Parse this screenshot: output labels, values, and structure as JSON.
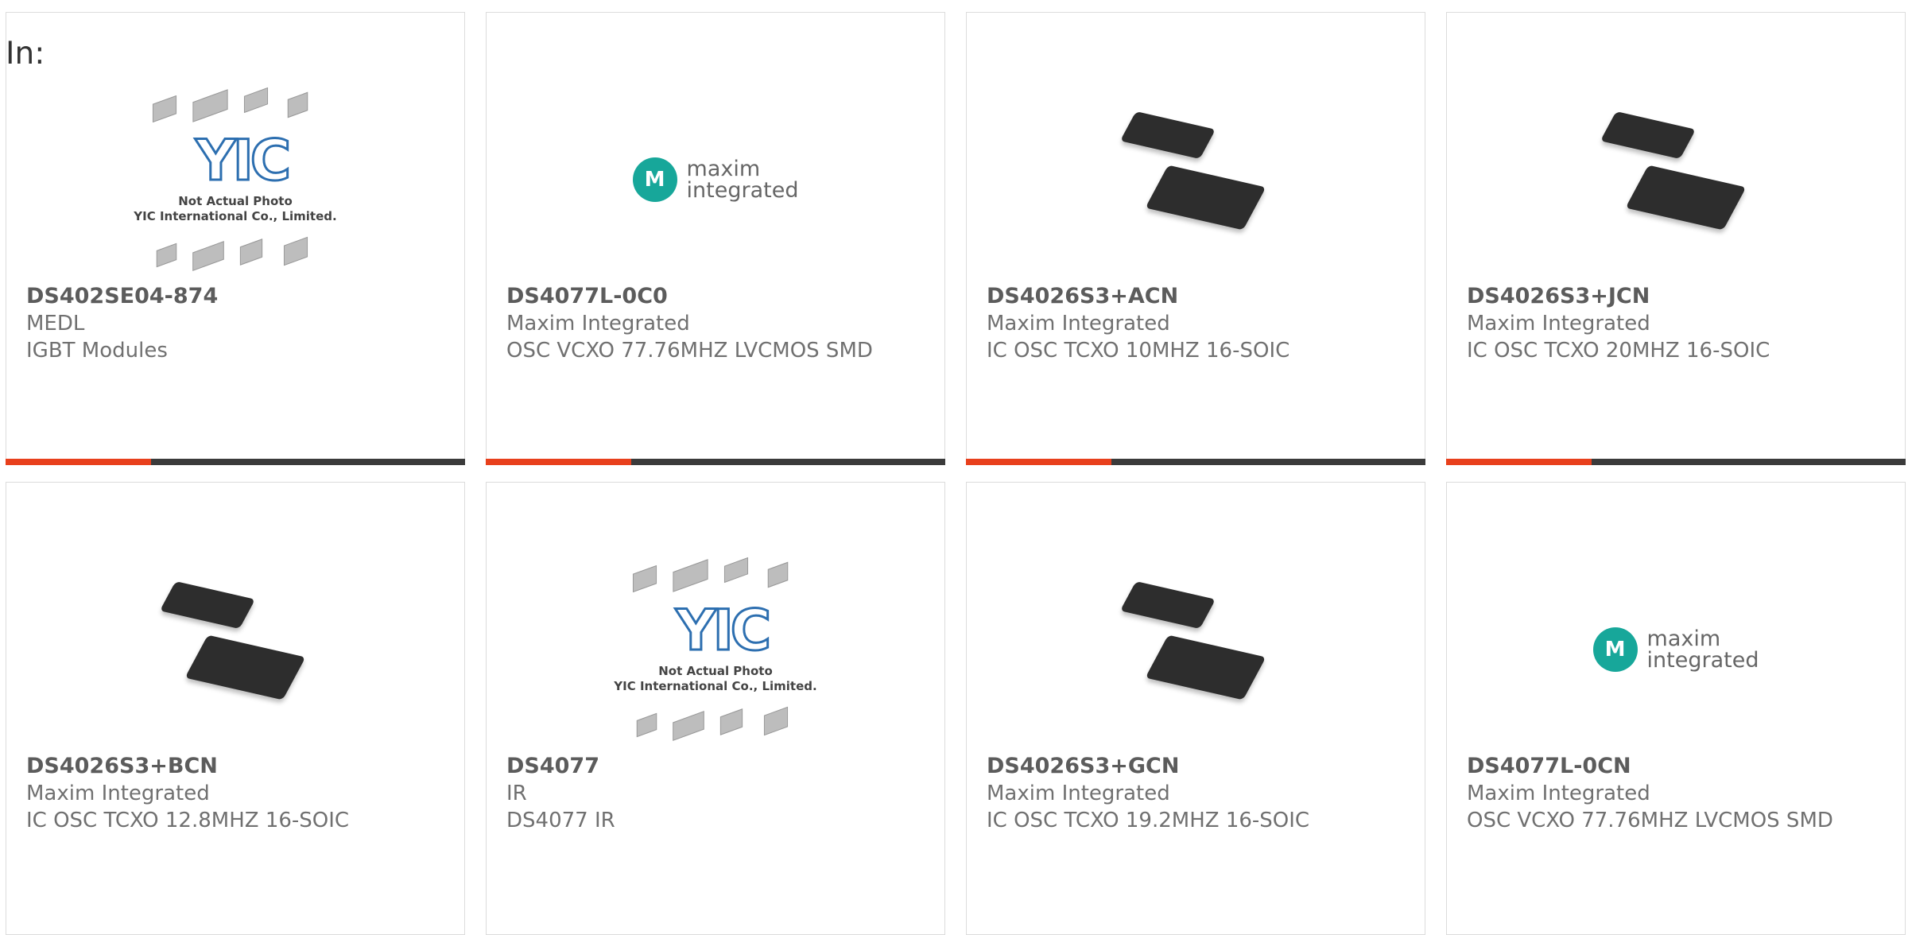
{
  "heading": "In:",
  "colors": {
    "accent": "#e8401c",
    "bar": "#3b3b3b",
    "maxim_teal": "#17a79a"
  },
  "placeholder": {
    "line1": "Not Actual Photo",
    "line2": "YIC International Co., Limited.",
    "logo": "YIC"
  },
  "maxim_logo": {
    "symbol": "M",
    "line1": "maxim",
    "line2": "integrated"
  },
  "products": [
    {
      "part": "DS402SE04-874",
      "manufacturer": "MEDL",
      "description": "IGBT Modules",
      "image": "yic-placeholder"
    },
    {
      "part": "DS4077L-0C0",
      "manufacturer": "Maxim Integrated",
      "description": "OSC VCXO 77.76MHZ LVCMOS SMD",
      "image": "maxim-logo"
    },
    {
      "part": "DS4026S3+ACN",
      "manufacturer": "Maxim Integrated",
      "description": "IC OSC TCXO 10MHZ 16-SOIC",
      "image": "soic-chip"
    },
    {
      "part": "DS4026S3+JCN",
      "manufacturer": "Maxim Integrated",
      "description": "IC OSC TCXO 20MHZ 16-SOIC",
      "image": "soic-chip"
    },
    {
      "part": "DS4026S3+BCN",
      "manufacturer": "Maxim Integrated",
      "description": "IC OSC TCXO 12.8MHZ 16-SOIC",
      "image": "soic-chip"
    },
    {
      "part": "DS4077",
      "manufacturer": "IR",
      "description": "DS4077 IR",
      "image": "yic-placeholder"
    },
    {
      "part": "DS4026S3+GCN",
      "manufacturer": "Maxim Integrated",
      "description": "IC OSC TCXO 19.2MHZ 16-SOIC",
      "image": "soic-chip"
    },
    {
      "part": "DS4077L-0CN",
      "manufacturer": "Maxim Integrated",
      "description": "OSC VCXO 77.76MHZ LVCMOS SMD",
      "image": "maxim-logo"
    }
  ]
}
